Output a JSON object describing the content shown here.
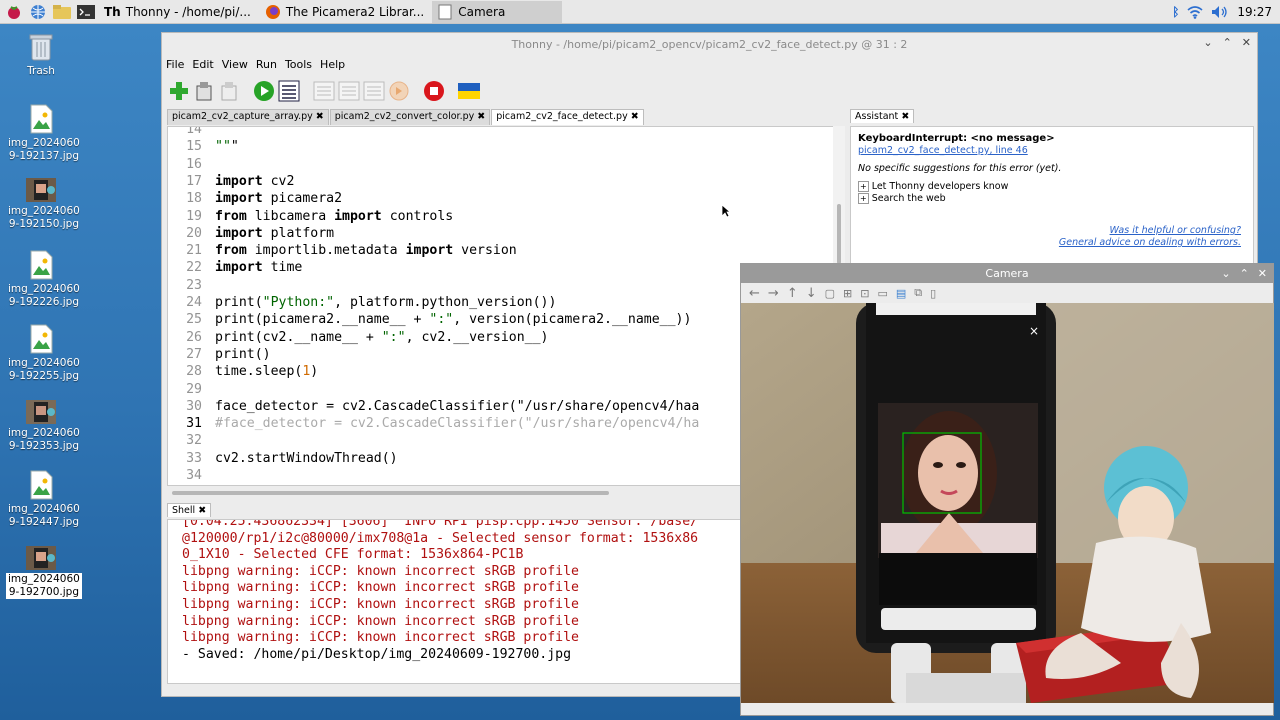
{
  "taskbar": {
    "tasks": [
      {
        "label": "Thonny - /home/pi/...",
        "icon": "thonny-icon"
      },
      {
        "label": "The Picamera2 Librar...",
        "icon": "firefox-icon"
      },
      {
        "label": "Camera",
        "icon": "window-icon"
      }
    ],
    "clock": "19:27"
  },
  "desktop": {
    "icons": [
      {
        "label": "Trash",
        "kind": "trash-icon"
      },
      {
        "label": "img_2024060\n9-192137.jpg",
        "kind": "image-file-icon"
      },
      {
        "label": "img_2024060\n9-192150.jpg",
        "kind": "photo-thumb"
      },
      {
        "label": "img_2024060\n9-192226.jpg",
        "kind": "image-file-icon"
      },
      {
        "label": "img_2024060\n9-192255.jpg",
        "kind": "image-file-icon"
      },
      {
        "label": "img_2024060\n9-192353.jpg",
        "kind": "photo-thumb"
      },
      {
        "label": "img_2024060\n9-192447.jpg",
        "kind": "image-file-icon"
      },
      {
        "label": "img_2024060\n9-192700.jpg",
        "kind": "photo-thumb"
      }
    ]
  },
  "thonny": {
    "title": "Thonny  -  /home/pi/picam2_opencv/picam2_cv2_face_detect.py  @  31 : 2",
    "menu": [
      "File",
      "Edit",
      "View",
      "Run",
      "Tools",
      "Help"
    ],
    "tabs": [
      {
        "label": "picam2_cv2_capture_array.py",
        "active": false
      },
      {
        "label": "picam2_cv2_convert_color.py",
        "active": false
      },
      {
        "label": "picam2_cv2_face_detect.py",
        "active": true
      }
    ],
    "code": [
      {
        "n": "14",
        "t": ""
      },
      {
        "n": "15",
        "t": "\"\"\""
      },
      {
        "n": "16",
        "t": ""
      },
      {
        "n": "17",
        "t": "import cv2"
      },
      {
        "n": "18",
        "t": "import picamera2"
      },
      {
        "n": "19",
        "t": "from libcamera import controls"
      },
      {
        "n": "20",
        "t": "import platform"
      },
      {
        "n": "21",
        "t": "from importlib.metadata import version"
      },
      {
        "n": "22",
        "t": "import time"
      },
      {
        "n": "23",
        "t": ""
      },
      {
        "n": "24",
        "t": "print(\"Python:\", platform.python_version())"
      },
      {
        "n": "25",
        "t": "print(picamera2.__name__ + \":\", version(picamera2.__name__))"
      },
      {
        "n": "26",
        "t": "print(cv2.__name__ + \":\", cv2.__version__)"
      },
      {
        "n": "27",
        "t": "print()"
      },
      {
        "n": "28",
        "t": "time.sleep(1)"
      },
      {
        "n": "29",
        "t": ""
      },
      {
        "n": "30",
        "t": "face_detector = cv2.CascadeClassifier(\"/usr/share/opencv4/haa"
      },
      {
        "n": "31",
        "t": "#face_detector = cv2.CascadeClassifier(\"/usr/share/opencv4/ha"
      },
      {
        "n": "32",
        "t": ""
      },
      {
        "n": "33",
        "t": "cv2.startWindowThread()"
      },
      {
        "n": "34",
        "t": ""
      }
    ],
    "shell_tab": "Shell",
    "shell": [
      {
        "t": "[0:04:25.436862334] [3606]  INFO RPI pisp.cpp:1450 Sensor: /base/",
        "ok": false
      },
      {
        "t": "@120000/rp1/i2c@80000/imx708@1a - Selected sensor format: 1536x86",
        "ok": false
      },
      {
        "t": "0_1X10 - Selected CFE format: 1536x864-PC1B",
        "ok": false
      },
      {
        "t": "libpng warning: iCCP: known incorrect sRGB profile",
        "ok": false
      },
      {
        "t": "libpng warning: iCCP: known incorrect sRGB profile",
        "ok": false
      },
      {
        "t": "libpng warning: iCCP: known incorrect sRGB profile",
        "ok": false
      },
      {
        "t": "libpng warning: iCCP: known incorrect sRGB profile",
        "ok": false
      },
      {
        "t": "libpng warning: iCCP: known incorrect sRGB profile",
        "ok": false
      },
      {
        "t": "- Saved: /home/pi/Desktop/img_20240609-192700.jpg",
        "ok": true
      }
    ]
  },
  "assistant": {
    "tab": "Assistant",
    "error_title": "KeyboardInterrupt: <no message>",
    "error_link": "picam2_cv2_face_detect.py, line 46",
    "no_suggestions": "No specific suggestions for this error (yet).",
    "expanders": [
      "Let Thonny developers know",
      "Search the web"
    ],
    "helpful_link": "Was it helpful or confusing?",
    "advice_link": "General advice on dealing with errors."
  },
  "camera": {
    "title": "Camera",
    "tools": [
      "back-icon",
      "forward-icon",
      "up-icon",
      "down-icon",
      "zoom-reset-icon",
      "zoom-fit-icon",
      "home-icon",
      "pan-icon",
      "zoom-in-icon",
      "save-icon"
    ]
  },
  "colors": {
    "desktop": "#2f79b8",
    "error_text": "#b01010",
    "link": "#2a62c8",
    "face_box": "#00c000"
  }
}
